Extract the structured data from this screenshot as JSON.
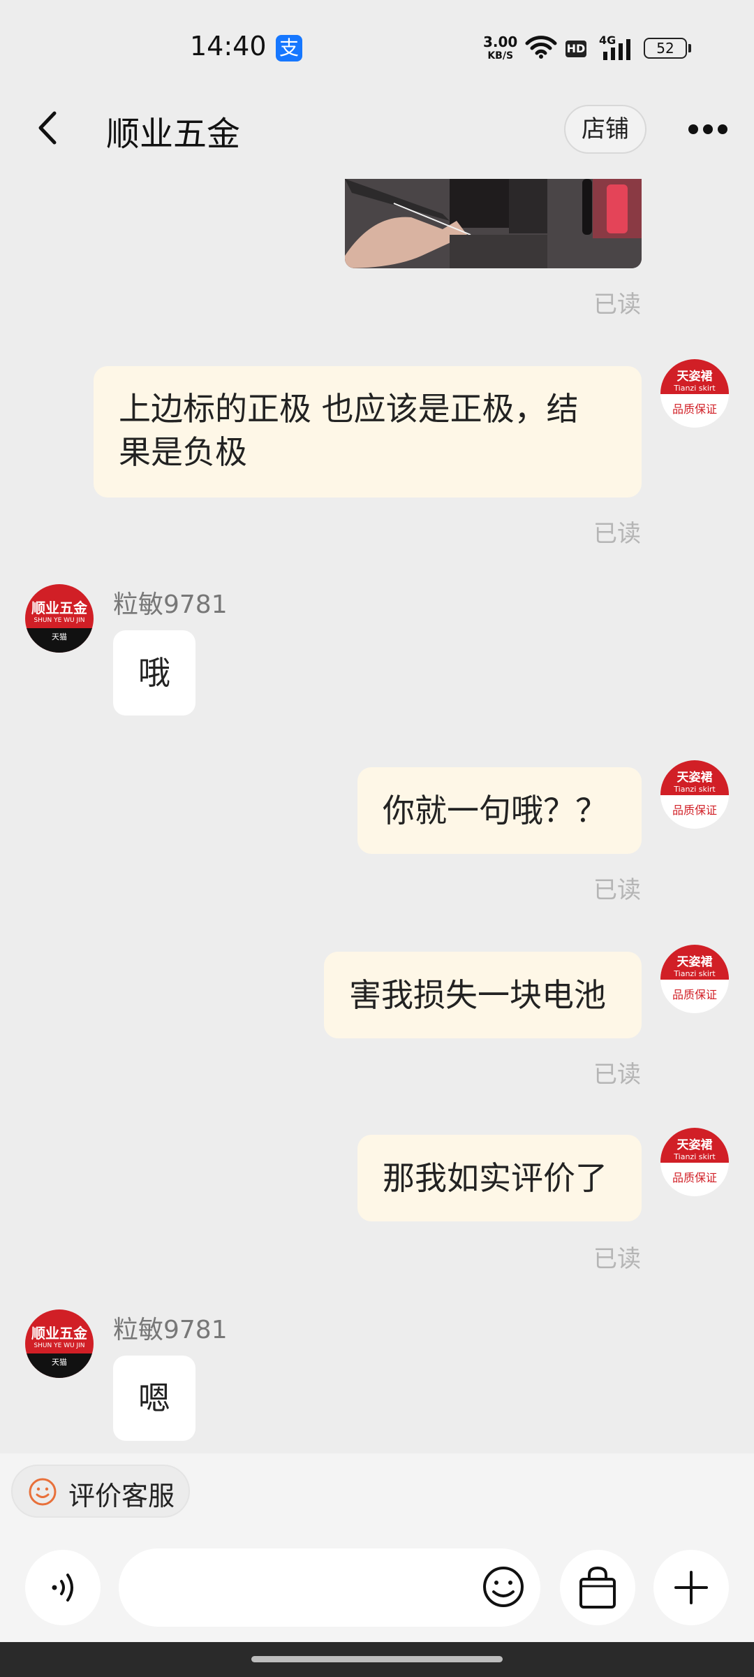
{
  "status_bar": {
    "time": "14:40",
    "alipay_icon": "支",
    "net_speed_value": "3.00",
    "net_speed_unit": "KB/S",
    "hd_badge": "HD",
    "network_type": "4G",
    "battery": "52"
  },
  "header": {
    "title": "顺业五金",
    "shop_button": "店铺"
  },
  "messages": [
    {
      "from": "me",
      "type": "image",
      "status": "已读"
    },
    {
      "from": "me",
      "type": "text",
      "text_line1": "上边标的正极 也应该是正极，结",
      "text_line2": "果是负极",
      "status": "已读",
      "avatar_line1": "天姿裙",
      "avatar_line2": "Tianzi skirt",
      "avatar_line3": "品质保证"
    },
    {
      "from": "other",
      "sender": "粒敏9781",
      "text": "哦",
      "avatar_line1": "顺业五金",
      "avatar_line2": "SHUN YE WU JIN",
      "avatar_line3": "天猫"
    },
    {
      "from": "me",
      "type": "text",
      "text": "你就一句哦？？",
      "status": "已读",
      "avatar_line1": "天姿裙",
      "avatar_line2": "Tianzi skirt",
      "avatar_line3": "品质保证"
    },
    {
      "from": "me",
      "type": "text",
      "text": "害我损失一块电池",
      "status": "已读",
      "avatar_line1": "天姿裙",
      "avatar_line2": "Tianzi skirt",
      "avatar_line3": "品质保证"
    },
    {
      "from": "me",
      "type": "text",
      "text": "那我如实评价了",
      "status": "已读",
      "avatar_line1": "天姿裙",
      "avatar_line2": "Tianzi skirt",
      "avatar_line3": "品质保证"
    },
    {
      "from": "other",
      "sender": "粒敏9781",
      "text": "嗯",
      "avatar_line1": "顺业五金",
      "avatar_line2": "SHUN YE WU JIN",
      "avatar_line3": "天猫"
    }
  ],
  "bottom": {
    "rate_service_label": "评价客服",
    "input_value": ""
  },
  "colors": {
    "my_bubble": "#fef7e7",
    "background": "#ededed",
    "avatar_red": "#d11f26",
    "rate_icon_orange": "#e8703a"
  }
}
